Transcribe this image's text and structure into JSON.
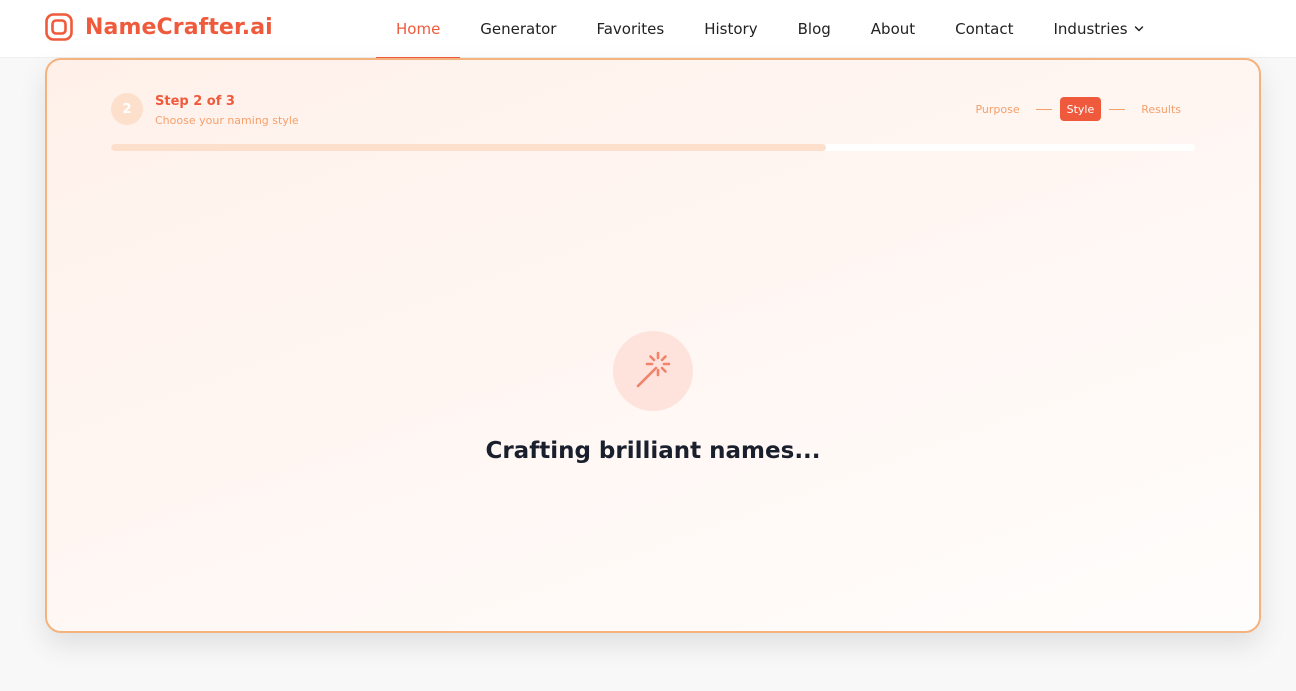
{
  "brand": {
    "name": "NameCrafter.ai",
    "icon": "brand-logo-icon",
    "color": "#f05a3c"
  },
  "nav": {
    "items": [
      {
        "label": "Home",
        "active": true
      },
      {
        "label": "Generator"
      },
      {
        "label": "Favorites"
      },
      {
        "label": "History"
      },
      {
        "label": "Blog"
      },
      {
        "label": "About"
      },
      {
        "label": "Contact"
      },
      {
        "label": "Industries",
        "dropdown": true,
        "icon": "chevron-down-icon"
      }
    ]
  },
  "wizard": {
    "step_number": "2",
    "step_title": "Step 2 of 3",
    "step_subtitle": "Choose your naming style",
    "steps": [
      {
        "label": "Purpose"
      },
      {
        "label": "Style",
        "active": true
      },
      {
        "label": "Results"
      }
    ],
    "progress_fraction": 0.66
  },
  "loading": {
    "icon": "magic-wand-icon",
    "text": "Crafting brilliant names..."
  },
  "colors": {
    "accent": "#f05a3c",
    "accent_light": "#fde0cc",
    "card_border": "#f4b27e",
    "text_dark": "#1a1f2e"
  }
}
